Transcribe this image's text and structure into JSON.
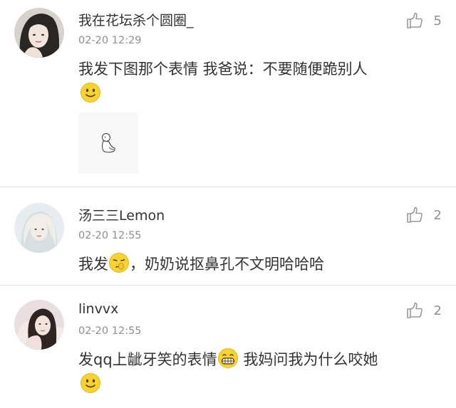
{
  "comments": [
    {
      "username": "我在花坛杀个圆圈_",
      "time": "02-20 12:29",
      "likes": "5",
      "text": "我发下图那个表情 我爸说：不要随便跪别人",
      "trailing_emoji": "smile-emoji",
      "sticker": "kneeling-figure-sticker"
    },
    {
      "username": "汤三三Lemon",
      "time": "02-20 12:55",
      "likes": "2",
      "text_before": "我发",
      "inline_emoji": "nose-pick-emoji",
      "text_after": "，奶奶说抠鼻孔不文明哈哈哈"
    },
    {
      "username": "linvvx",
      "time": "02-20 12:55",
      "likes": "2",
      "text_before": "发qq上龇牙笑的表情",
      "inline_emoji": "grin-emoji",
      "text_after": " 我妈问我为什么咬她",
      "trailing_emoji": "smile-emoji"
    }
  ],
  "icons": {
    "like": "thumbs-up-icon"
  },
  "colors": {
    "primary_text": "#333333",
    "secondary_text": "#8f8f8f",
    "divider": "#e2e2e2",
    "emoji_yellow": "#f7d331"
  }
}
